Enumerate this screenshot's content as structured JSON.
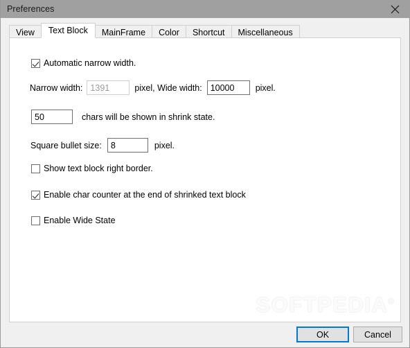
{
  "window": {
    "title": "Preferences",
    "close_icon": "close-icon",
    "titlebar_color": "#a0a0a0"
  },
  "tabs": [
    {
      "label": "View",
      "active": false
    },
    {
      "label": "Text Block",
      "active": true
    },
    {
      "label": "MainFrame",
      "active": false
    },
    {
      "label": "Color",
      "active": false
    },
    {
      "label": "Shortcut",
      "active": false
    },
    {
      "label": "Miscellaneous",
      "active": false
    }
  ],
  "form": {
    "auto_narrow_width": {
      "label": "Automatic narrow width.",
      "checked": true
    },
    "narrow_width": {
      "label": "Narrow width:",
      "value": "1391",
      "unit": "pixel, Wide width:",
      "disabled": true
    },
    "wide_width": {
      "value": "10000",
      "unit": "pixel.",
      "disabled": false
    },
    "shrink_chars": {
      "value": "50",
      "label": "chars will be shown in shrink state."
    },
    "square_bullet": {
      "label": "Square bullet size:",
      "value": "8",
      "unit": "pixel."
    },
    "show_right_border": {
      "label": "Show text block right border.",
      "checked": false
    },
    "enable_char_counter": {
      "label": "Enable char counter at the end of shrinked text block",
      "checked": true
    },
    "enable_wide_state": {
      "label": "Enable Wide State",
      "checked": false
    }
  },
  "watermark": {
    "text": "SOFTPEDIA",
    "mark": "®"
  },
  "footer": {
    "ok_label": "OK",
    "cancel_label": "Cancel",
    "accent_color": "#0078d7"
  }
}
